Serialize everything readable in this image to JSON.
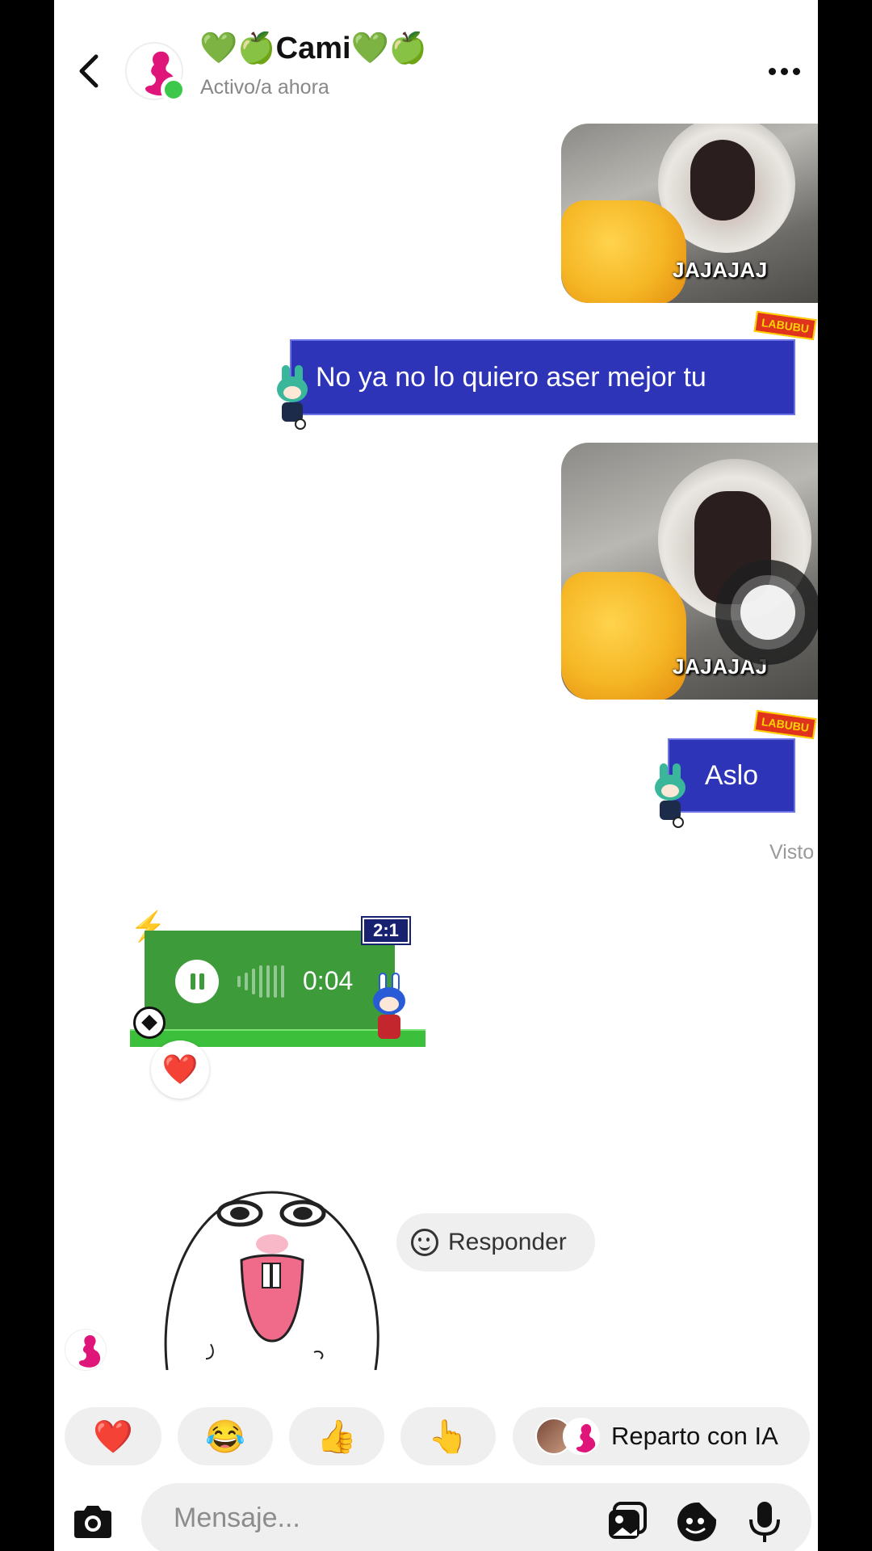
{
  "header": {
    "title": "💚🍏Cami💚🍏",
    "status": "Activo/a ahora"
  },
  "messages": {
    "image1_caption": "JAJAJAJ",
    "text1": "No ya no lo quiero aser mejor tu",
    "image2_caption": "JAJAJAJ",
    "text2": "Aslo",
    "sticker_tag": "LABUBU",
    "seen": "Visto"
  },
  "voice_message": {
    "duration": "0:04",
    "score": "2:1",
    "reaction": "❤️"
  },
  "reply_pill": {
    "label": "Responder"
  },
  "quick_reactions": [
    "❤️",
    "😂",
    "👍",
    "👆"
  ],
  "ai_pill": {
    "label": "Reparto con IA"
  },
  "composer": {
    "placeholder": "Mensaje..."
  },
  "colors": {
    "bubble_blue": "#2d34b8",
    "voice_green": "#3d9b3a",
    "online_green": "#3cc84a",
    "brand_pink": "#e0157a"
  }
}
